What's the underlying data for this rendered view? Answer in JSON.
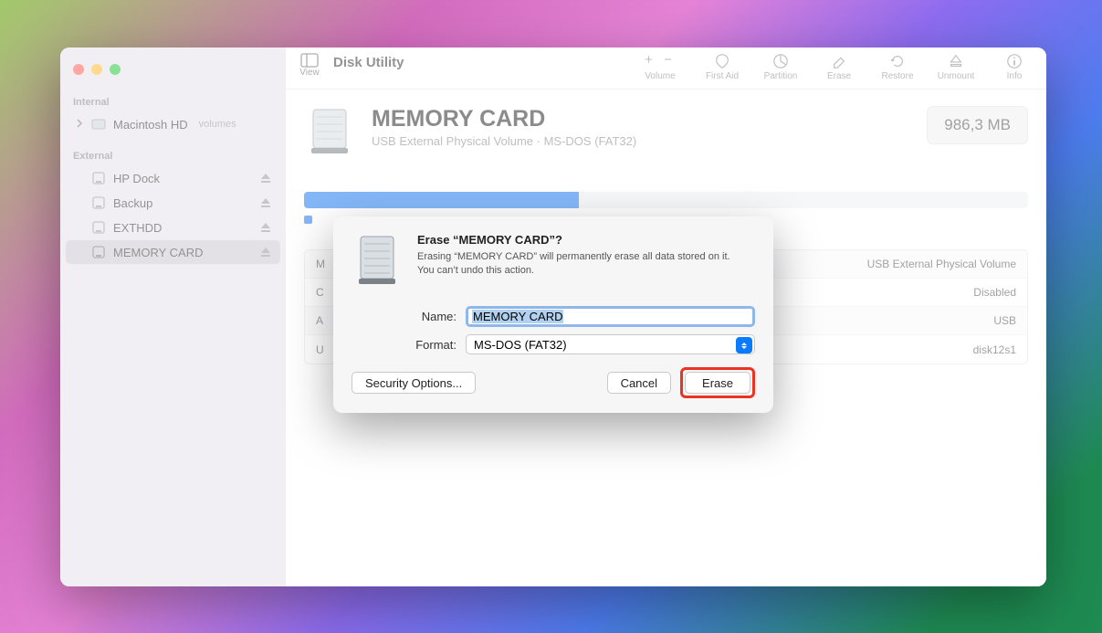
{
  "window": {
    "app_title": "Disk Utility"
  },
  "toolbar": {
    "view_label": "View",
    "buttons": {
      "volume": "Volume",
      "first_aid": "First Aid",
      "partition": "Partition",
      "erase": "Erase",
      "restore": "Restore",
      "unmount": "Unmount",
      "info": "Info"
    }
  },
  "sidebar": {
    "sections": {
      "internal": "Internal",
      "external": "External"
    },
    "internal_items": [
      {
        "name": "Macintosh HD",
        "suffix": "volumes"
      }
    ],
    "external_items": [
      {
        "name": "HP Dock"
      },
      {
        "name": "Backup"
      },
      {
        "name": "EXTHDD"
      },
      {
        "name": "MEMORY CARD",
        "selected": true
      }
    ]
  },
  "volume": {
    "title": "MEMORY CARD",
    "subtitle": "USB External Physical Volume · MS-DOS (FAT32)",
    "size": "986,3 MB"
  },
  "info_rows": [
    {
      "left_key": "M",
      "right": "USB External Physical Volume"
    },
    {
      "left_key": "C",
      "right": "Disabled"
    },
    {
      "left_key": "A",
      "right": "USB"
    },
    {
      "left_key": "U",
      "right": "disk12s1"
    }
  ],
  "modal": {
    "title": "Erase “MEMORY CARD”?",
    "description": "Erasing “MEMORY CARD” will permanently erase all data stored on it. You can’t undo this action.",
    "name_label": "Name:",
    "name_value": "MEMORY CARD",
    "format_label": "Format:",
    "format_value": "MS-DOS (FAT32)",
    "security_options": "Security Options...",
    "cancel": "Cancel",
    "erase": "Erase"
  }
}
